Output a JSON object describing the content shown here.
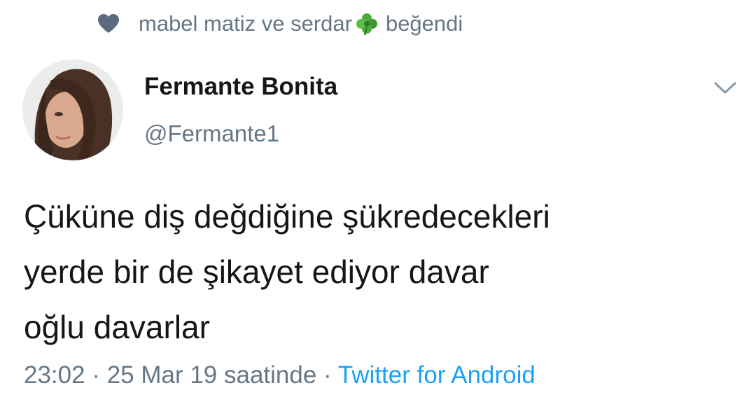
{
  "liked_by": {
    "icon": "heart-icon",
    "names": "mabel matiz ve serdar",
    "emoji": "clover-icon",
    "suffix": "beğendi"
  },
  "author": {
    "display_name": "Fermante Bonita",
    "handle": "@Fermante1",
    "avatar": "avatar-photo"
  },
  "menu_icon": "chevron-down-icon",
  "tweet": {
    "lines": [
      "Çüküne diş değdiğine şükredecekleri",
      "yerde bir de şikayet ediyor davar",
      "oğlu davarlar"
    ]
  },
  "meta": {
    "timestamp": "23:02 · 25 Mar 19 saatinde ·",
    "source": "Twitter for Android"
  },
  "colors": {
    "text": "#14171a",
    "secondary": "#657786",
    "link": "#1da1f2"
  }
}
